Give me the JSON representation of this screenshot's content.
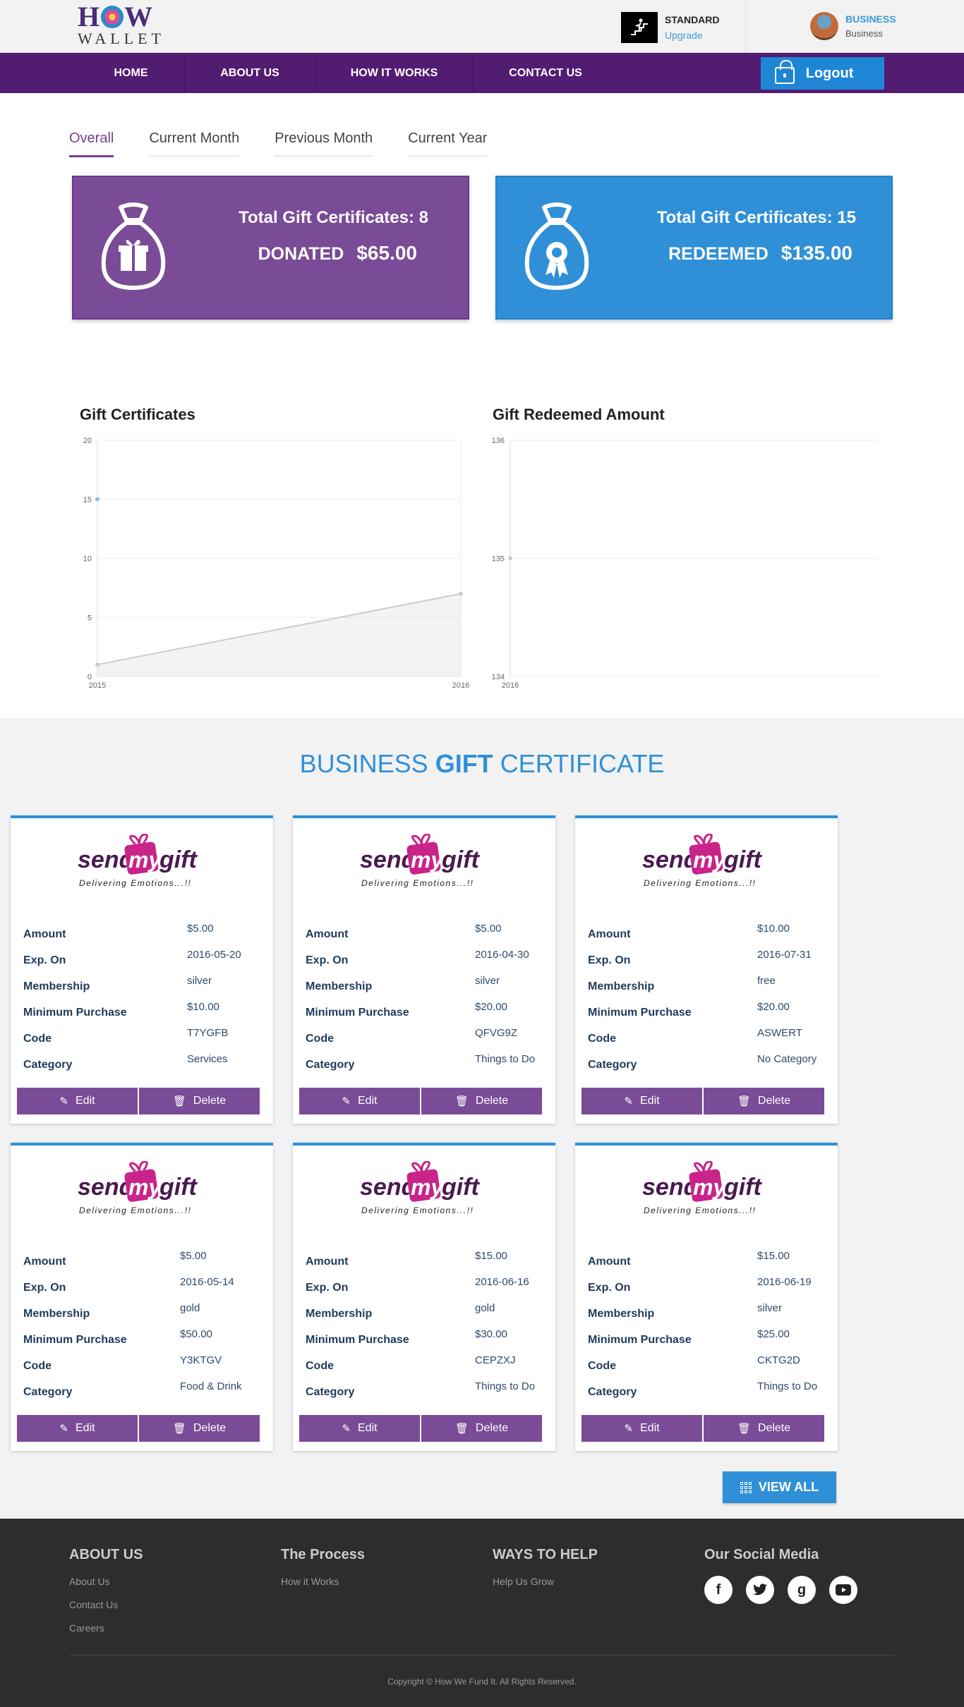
{
  "header": {
    "logo_top": "HOW",
    "logo_bottom": "WALLET",
    "plan_name": "STANDARD",
    "plan_action": "Upgrade",
    "account_type": "BUSINESS",
    "account_name": "Business"
  },
  "nav": {
    "items": [
      "HOME",
      "ABOUT US",
      "HOW IT WORKS",
      "CONTACT US"
    ],
    "logout_label": "Logout"
  },
  "tabs": [
    "Overall",
    "Current Month",
    "Previous Month",
    "Current Year"
  ],
  "active_tab": "Overall",
  "summary": {
    "donated": {
      "title": "Total Gift Certificates: 8",
      "label": "DONATED",
      "amount": "$65.00",
      "color": "#7a4b96"
    },
    "redeemed": {
      "title": "Total Gift Certificates: 15",
      "label": "REDEEMED",
      "amount": "$135.00",
      "color": "#2f90d8"
    }
  },
  "chart_data": [
    {
      "type": "area",
      "title": "Gift Certificates",
      "x": [
        "2015",
        "2016"
      ],
      "series": [
        {
          "values": [
            1,
            7
          ],
          "color": "#cccccc"
        },
        {
          "values": [
            15,
            null
          ],
          "color": "#97bbcd"
        }
      ],
      "yticks": [
        "0",
        "5",
        "10",
        "15",
        "20"
      ],
      "ylim": [
        0,
        20
      ],
      "grid": true
    },
    {
      "type": "line",
      "title": "Gift Redeemed Amount",
      "x": [
        "2016"
      ],
      "series": [
        {
          "values": [
            135
          ],
          "color": "#cccccc"
        }
      ],
      "yticks": [
        "134",
        "135",
        "136"
      ],
      "ylim": [
        134,
        136
      ],
      "grid": true
    }
  ],
  "gift_section": {
    "heading_pre": "BUSINESS",
    "heading_bold": "GIFT",
    "heading_post": "CERTIFICATE",
    "logo_word1": "send",
    "logo_word2": "my",
    "logo_word3": "gift",
    "logo_tagline": "Delivering Emotions...!!",
    "field_labels": [
      "Amount",
      "Exp. On",
      "Membership",
      "Minimum Purchase",
      "Code",
      "Category"
    ],
    "edit_label": "Edit",
    "delete_label": "Delete",
    "cards": [
      {
        "values": [
          "$5.00",
          "2016-05-20",
          "silver",
          "$10.00",
          "T7YGFB",
          "Services"
        ]
      },
      {
        "values": [
          "$5.00",
          "2016-04-30",
          "silver",
          "$20.00",
          "QFVG9Z",
          "Things to Do"
        ]
      },
      {
        "values": [
          "$10.00",
          "2016-07-31",
          "free",
          "$20.00",
          "ASWERT",
          "No Category"
        ]
      },
      {
        "values": [
          "$5.00",
          "2016-05-14",
          "gold",
          "$50.00",
          "Y3KTGV",
          "Food & Drink"
        ]
      },
      {
        "values": [
          "$15.00",
          "2016-06-16",
          "gold",
          "$30.00",
          "CEPZXJ",
          "Things to Do"
        ]
      },
      {
        "values": [
          "$15.00",
          "2016-06-19",
          "silver",
          "$25.00",
          "CKTG2D",
          "Things to Do"
        ]
      }
    ],
    "view_all_label": "VIEW ALL"
  },
  "footer": {
    "about": {
      "title": "ABOUT US",
      "links": [
        "About Us",
        "Contact Us",
        "Careers"
      ]
    },
    "process": {
      "title": "The Process",
      "links": [
        "How it Works"
      ]
    },
    "help": {
      "title": "WAYS TO HELP",
      "links": [
        "Help Us Grow"
      ]
    },
    "social": {
      "title": "Our Social Media",
      "icons": [
        "facebook-icon",
        "twitter-icon",
        "google-plus-icon",
        "youtube-icon"
      ]
    },
    "copyright": "Copyright © How We Fund It. All Rights Reserved."
  }
}
